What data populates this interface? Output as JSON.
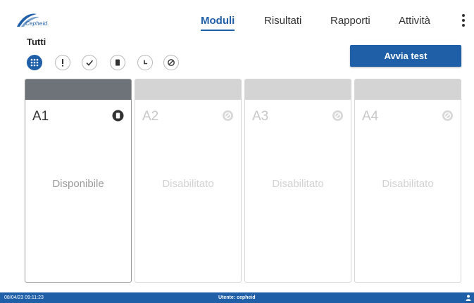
{
  "app": {
    "logo_text": "Cepheid.",
    "brand_color": "#1f5fa8"
  },
  "nav": {
    "tabs": [
      {
        "label": "Moduli",
        "active": true
      },
      {
        "label": "Risultati",
        "active": false
      },
      {
        "label": "Rapporti",
        "active": false
      },
      {
        "label": "Attività",
        "active": false
      }
    ],
    "menu_icon": "more-vertical-icon"
  },
  "filter": {
    "label": "Tutti",
    "buttons": [
      {
        "icon": "grid-icon",
        "active": true
      },
      {
        "icon": "exclamation-icon",
        "active": false
      },
      {
        "icon": "check-icon",
        "active": false
      },
      {
        "icon": "cartridge-icon",
        "active": false
      },
      {
        "icon": "clock-icon",
        "active": false
      },
      {
        "icon": "disabled-icon",
        "active": false
      }
    ]
  },
  "actions": {
    "start_test_label": "Avvia test"
  },
  "modules": [
    {
      "name": "A1",
      "status": "Disponibile",
      "icon": "cartridge-icon",
      "selected": true
    },
    {
      "name": "A2",
      "status": "Disabilitato",
      "icon": "disabled-icon",
      "selected": false
    },
    {
      "name": "A3",
      "status": "Disabilitato",
      "icon": "disabled-icon",
      "selected": false
    },
    {
      "name": "A4",
      "status": "Disabilitato",
      "icon": "disabled-icon",
      "selected": false
    }
  ],
  "footer": {
    "datetime": "08/04/23 09:11:23",
    "user": "Utente: cepheid",
    "icon": "user-icon"
  }
}
